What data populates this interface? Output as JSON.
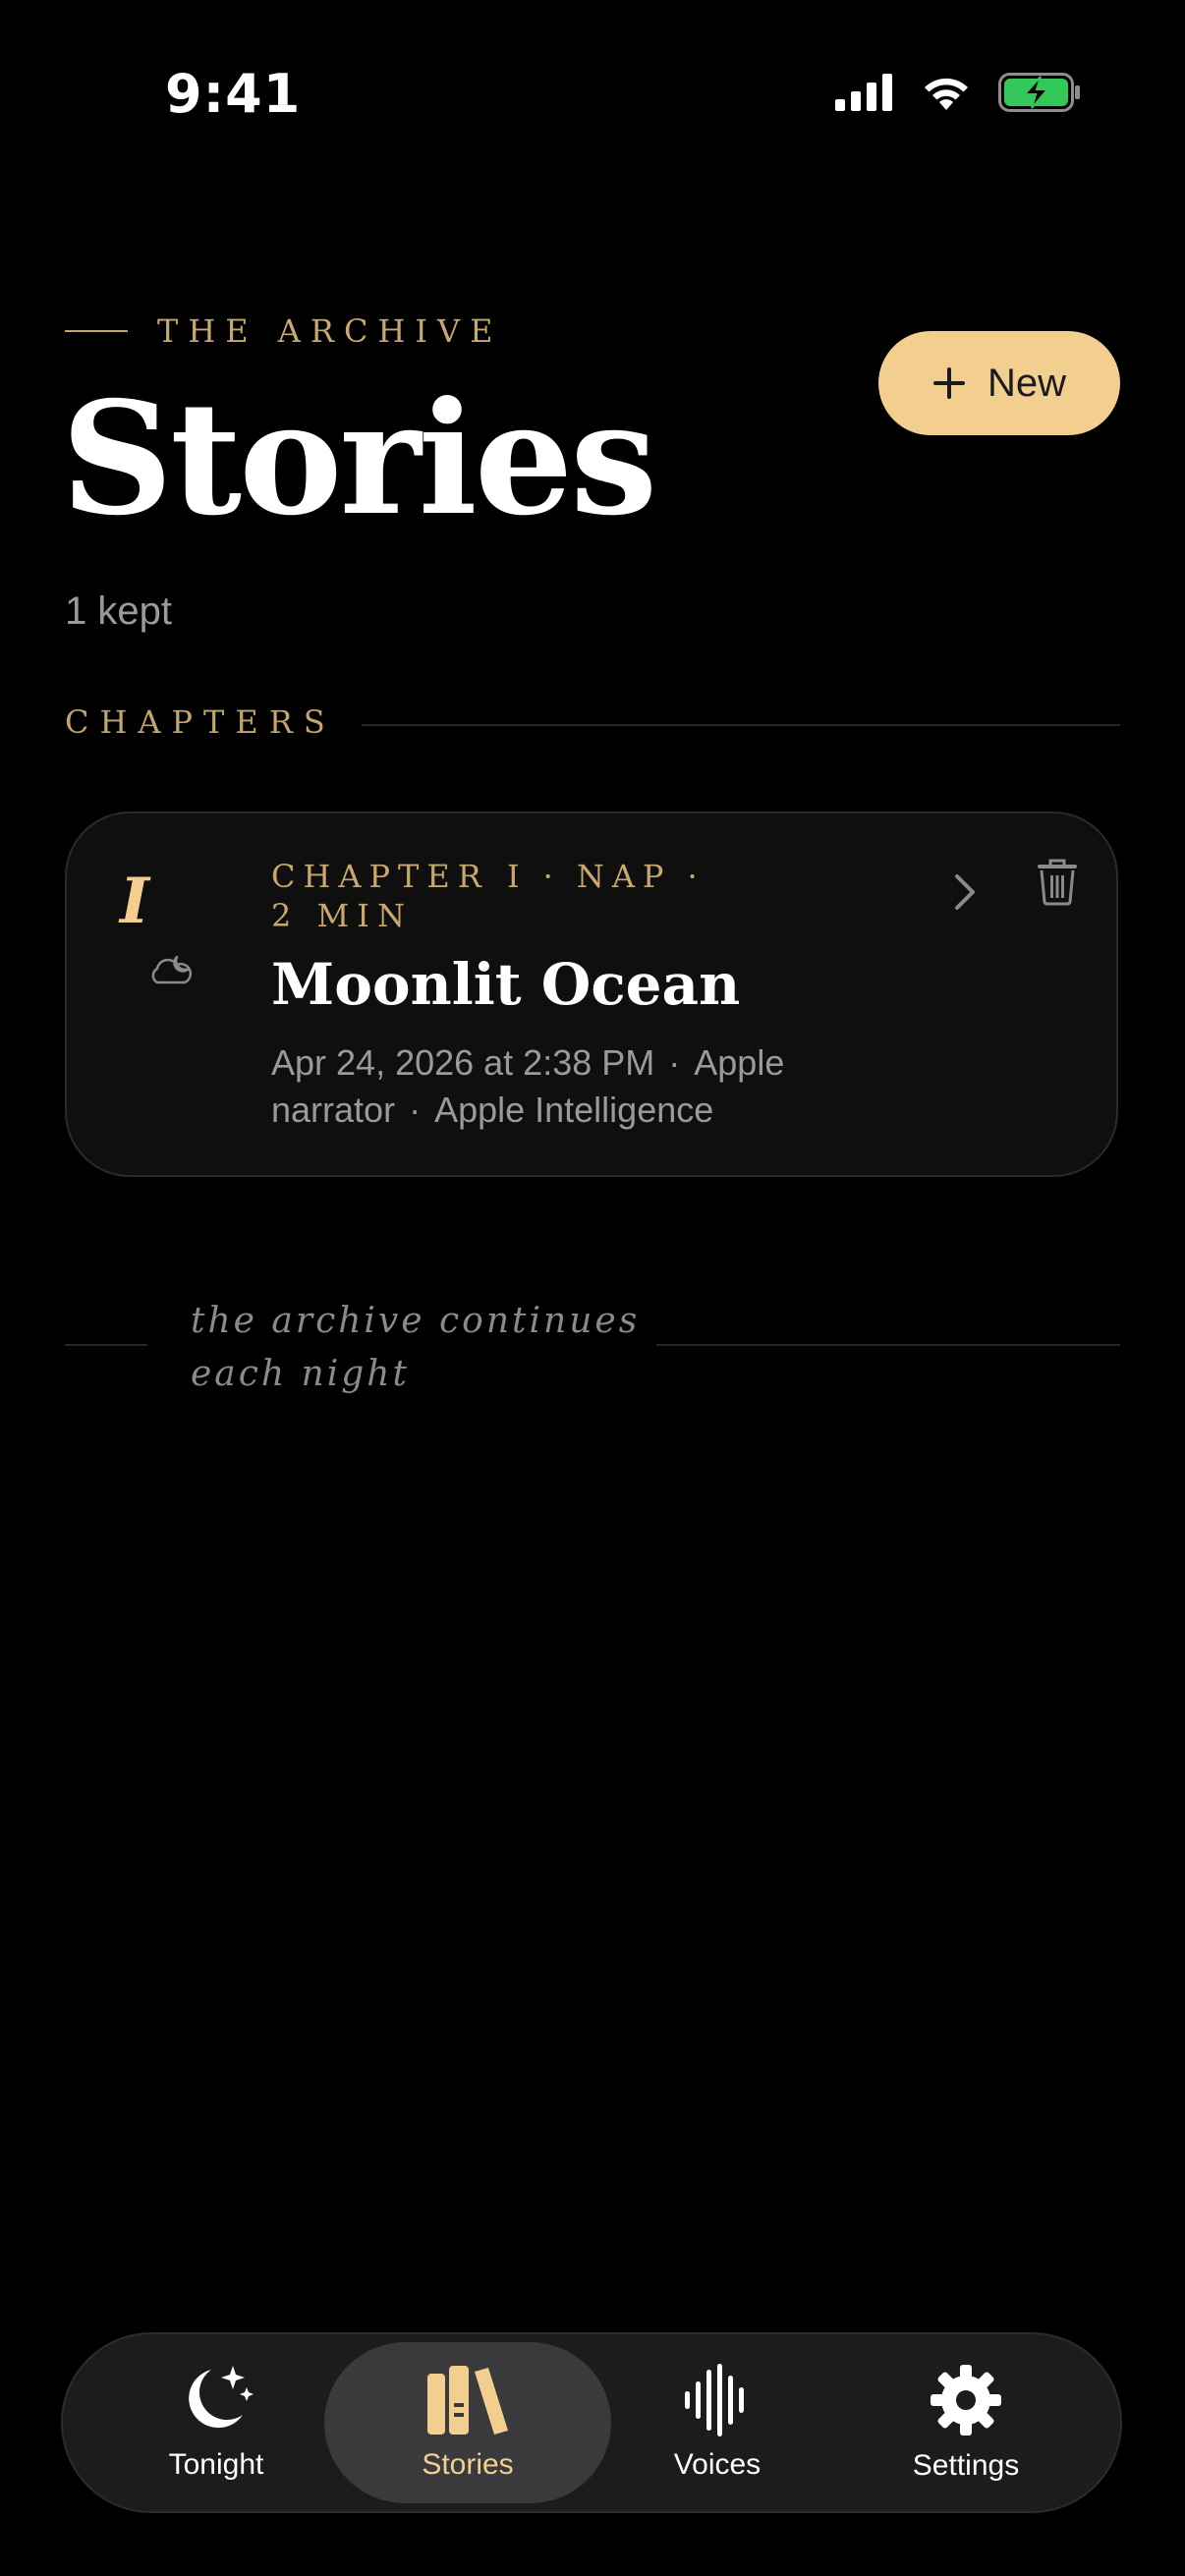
{
  "status": {
    "time": "9:41"
  },
  "header": {
    "kicker": "THE ARCHIVE",
    "title": "Stories",
    "count": "1 kept",
    "new_label": "New"
  },
  "section": {
    "label": "CHAPTERS"
  },
  "stories": [
    {
      "numeral": "I",
      "meta_chapter": "CHAPTER I",
      "meta_type": "NAP",
      "meta_duration": "2 MIN",
      "title": "Moonlit Ocean",
      "date": "Apr 24, 2026 at 2:38 PM",
      "narrator": "Apple narrator",
      "source": "Apple Intelligence"
    }
  ],
  "footer_note": "the archive continues each night",
  "tabs": [
    {
      "label": "Tonight",
      "icon": "moon-stars-icon",
      "active": false
    },
    {
      "label": "Stories",
      "icon": "books-icon",
      "active": true
    },
    {
      "label": "Voices",
      "icon": "waveform-icon",
      "active": false
    },
    {
      "label": "Settings",
      "icon": "gear-icon",
      "active": false
    }
  ],
  "colors": {
    "background": "#000000",
    "accent": "#f2cf8e",
    "gold_text": "#c9a86f",
    "card": "#0f0f0f",
    "muted": "#9a9a9a",
    "battery": "#34c759"
  }
}
